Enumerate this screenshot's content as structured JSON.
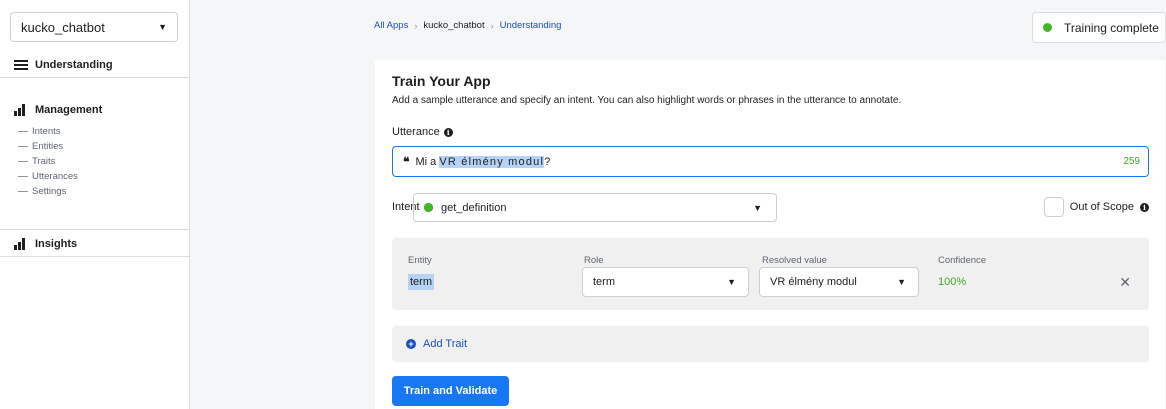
{
  "sidebar": {
    "app_name": "kucko_chatbot",
    "understanding_label": "Understanding",
    "management_label": "Management",
    "management_items": [
      "Intents",
      "Entities",
      "Traits",
      "Utterances",
      "Settings"
    ],
    "insights_label": "Insights"
  },
  "breadcrumb": [
    "All Apps",
    "kucko_chatbot",
    "Understanding"
  ],
  "status": {
    "label": "Training complete",
    "color": "#42b72a"
  },
  "train": {
    "title": "Train Your App",
    "description": "Add a sample utterance and specify an intent. You can also highlight words or phrases in the utterance to annotate.",
    "utterance_label": "Utterance",
    "utterance_prefix": "Mi a ",
    "utterance_highlight": "VR élmény modul",
    "utterance_suffix": "?",
    "char_count": "259",
    "intent_label": "Intent",
    "intent_value": "get_definition",
    "out_of_scope_label": "Out of Scope",
    "entity": {
      "col_entity": "Entity",
      "col_role": "Role",
      "col_resolved": "Resolved value",
      "col_confidence": "Confidence",
      "entity_name": "term",
      "role_value": "term",
      "resolved_value": "VR élmény modul",
      "confidence": "100%"
    },
    "add_trait_label": "Add Trait",
    "submit_label": "Train and Validate"
  },
  "colors": {
    "accent": "#1877f2",
    "highlight": "#b6d2f5",
    "success": "#42b72a"
  }
}
